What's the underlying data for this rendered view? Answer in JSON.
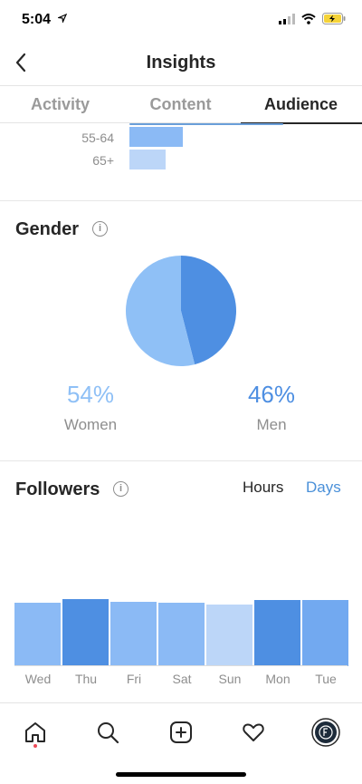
{
  "status_bar": {
    "time": "5:04",
    "location_icon": "location-arrow-icon",
    "signal_icon": "cellular-signal-icon",
    "wifi_icon": "wifi-icon",
    "battery_icon": "battery-charging-icon",
    "battery_color": "#f5d338"
  },
  "header": {
    "title": "Insights",
    "back_icon": "chevron-left-icon"
  },
  "tabs": [
    {
      "label": "Activity",
      "active": false
    },
    {
      "label": "Content",
      "active": false
    },
    {
      "label": "Audience",
      "active": true
    }
  ],
  "age_range": {
    "rows": [
      {
        "label": "55-64",
        "color": "#8bbaf5"
      },
      {
        "label": "65+",
        "color": "#bcd6f8"
      }
    ]
  },
  "gender": {
    "title": "Gender",
    "info_icon": "info-icon",
    "women": {
      "percent": "54%",
      "label": "Women",
      "share": 54,
      "color": "#8fc0f6"
    },
    "men": {
      "percent": "46%",
      "label": "Men",
      "share": 46,
      "color": "#4e8fe2"
    }
  },
  "followers": {
    "title": "Followers",
    "info_icon": "info-icon",
    "toggle": {
      "hours": "Hours",
      "days": "Days",
      "selected": "Days"
    },
    "chart_data": {
      "type": "bar",
      "categories": [
        "Wed",
        "Thu",
        "Fri",
        "Sat",
        "Sun",
        "Mon",
        "Tue"
      ],
      "values": [
        0.95,
        1.0,
        0.96,
        0.95,
        0.92,
        0.99,
        0.99
      ],
      "colors": [
        "#8bbaf5",
        "#4e8fe2",
        "#8bbaf5",
        "#8bbaf5",
        "#bcd6f8",
        "#4e8fe2",
        "#72a9f0"
      ],
      "ylim": [
        0,
        1
      ]
    }
  },
  "tabbar": {
    "items": [
      "home-icon",
      "search-icon",
      "add-post-icon",
      "activity-heart-icon",
      "profile-icon"
    ],
    "home_dot_color": "#ed4956"
  },
  "colors": {
    "accent_blue": "#4a90d9",
    "text_dark": "#262626",
    "text_gray": "#8e8e8e"
  }
}
